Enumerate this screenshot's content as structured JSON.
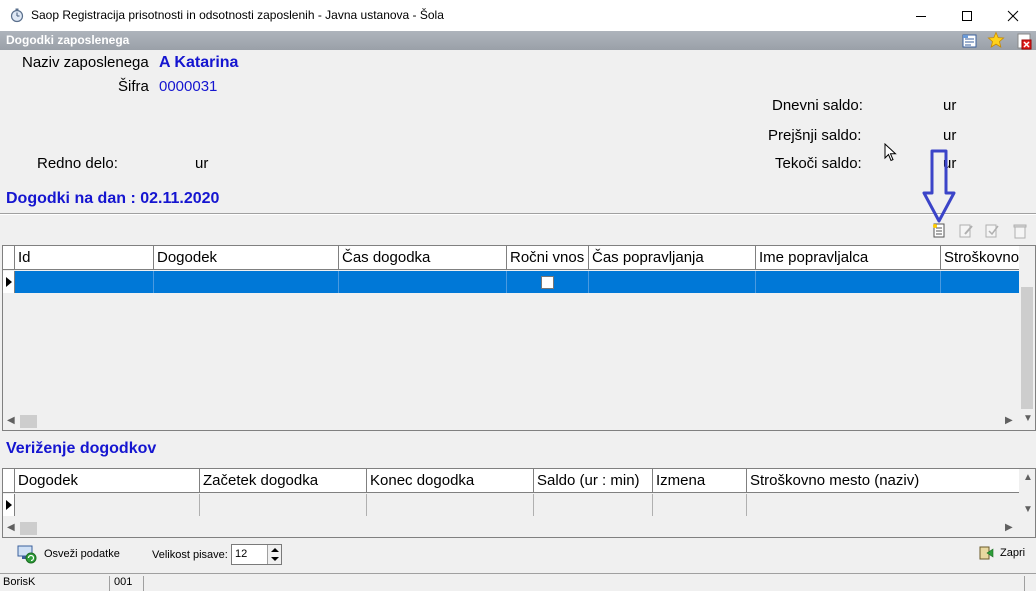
{
  "window": {
    "title": "Saop Registracija prisotnosti in odsotnosti zaposlenih - Javna ustanova - Šola",
    "header": "Dogodki zaposlenega"
  },
  "employee": {
    "name_label": "Naziv zaposlenega",
    "name_value": "A Katarina",
    "code_label": "Šifra",
    "code_value": "0000031"
  },
  "balances": {
    "daily_label": "Dnevni saldo:",
    "daily_unit": "ur",
    "previous_label": "Prejšnji saldo:",
    "previous_unit": "ur",
    "current_label": "Tekoči saldo:",
    "current_unit": "ur"
  },
  "regular": {
    "label": "Redno delo:",
    "unit": "ur"
  },
  "events_title": "Dogodki na dan : 02.11.2020",
  "events_grid": {
    "columns": [
      "Id",
      "Dogodek",
      "Čas dogodka",
      "Ročni vnos",
      "Čas popravljanja",
      "Ime popravljalca",
      "Stroškovno"
    ]
  },
  "chain_title": "Veriženje dogodkov",
  "chain_grid": {
    "columns": [
      "Dogodek",
      "Začetek dogodka",
      "Konec dogodka",
      "Saldo (ur : min)",
      "Izmena",
      "Stroškovno mesto (naziv)"
    ]
  },
  "footer": {
    "refresh_label": "Osveži podatke",
    "font_size_label": "Velikost pisave:",
    "font_size_value": "12",
    "close_label": "Zapri"
  },
  "status": {
    "user": "BorisK",
    "code": "001"
  },
  "colors": {
    "accent_blue": "#1515d0",
    "selection": "#0078d7",
    "header_strip": "#9aa0a8"
  }
}
